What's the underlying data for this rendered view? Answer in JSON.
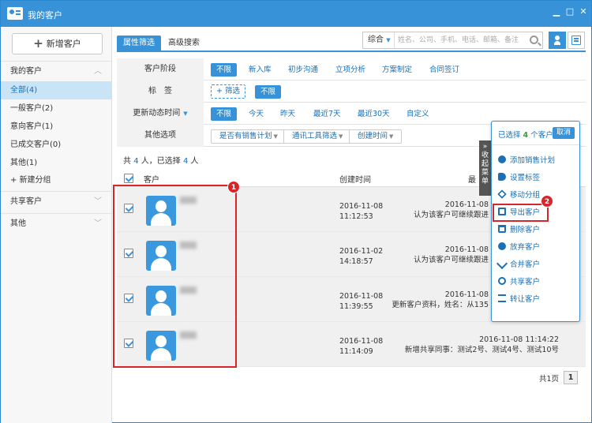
{
  "window": {
    "title": "我的客户",
    "minimize": "▁",
    "maximize": "□",
    "close": "✕"
  },
  "sidebar": {
    "new_button": "新增客户",
    "group_mine": "我的客户",
    "items": [
      {
        "label": "全部(4)"
      },
      {
        "label": "一般客户(2)"
      },
      {
        "label": "意向客户(1)"
      },
      {
        "label": "已成交客户(0)"
      },
      {
        "label": "其他(1)"
      }
    ],
    "new_group": "+ 新建分组",
    "group_shared": "共享客户",
    "group_other": "其他"
  },
  "tabs": [
    {
      "label": "属性筛选"
    },
    {
      "label": "高级搜索"
    }
  ],
  "search": {
    "type": "综合",
    "placeholder": "姓名、公司、手机、电话、邮箱、备注"
  },
  "filters": {
    "stage": {
      "label": "客户阶段",
      "options": [
        "不限",
        "新入库",
        "初步沟通",
        "立项分析",
        "方案制定",
        "合同签订"
      ]
    },
    "tags": {
      "label": "标　签",
      "add": "+ 筛选",
      "any": "不限"
    },
    "updated": {
      "label": "更新动态时间",
      "options": [
        "不限",
        "今天",
        "昨天",
        "最近7天",
        "最近30天",
        "自定义"
      ]
    },
    "other": {
      "label": "其他选项",
      "dropdowns": [
        "是否有销售计划",
        "通讯工具筛选",
        "创建时间"
      ]
    }
  },
  "summary": {
    "prefix": "共",
    "total": "4",
    "mid": "人，已选择",
    "selected": "4",
    "suffix": "人"
  },
  "table": {
    "columns": {
      "customer": "客户",
      "created": "创建时间",
      "latest": "最"
    },
    "rows": [
      {
        "date": "2016-11-08",
        "time": "11:12:53",
        "act_date": "2016-11-08",
        "act_text": "认为该客户可继续跟进"
      },
      {
        "date": "2016-11-02",
        "time": "14:18:57",
        "act_date": "2016-11-08",
        "act_text": "认为该客户可继续跟进"
      },
      {
        "date": "2016-11-08",
        "time": "11:39:55",
        "act_date": "2016-11-08",
        "act_text": "更新客户资料，姓名：从135"
      },
      {
        "date": "2016-11-08",
        "time": "11:14:09",
        "act_date": "2016-11-08 11:14:22",
        "act_text": "新增共享同事：测试2号、测试4号、测试10号"
      }
    ]
  },
  "collapse_tab": "收起菜单",
  "popup": {
    "selected_prefix": "已选择",
    "selected_count": "4",
    "selected_suffix": "个客户",
    "cancel": "取消",
    "items": [
      {
        "label": "添加销售计划",
        "icon": "plus-circle-icon"
      },
      {
        "label": "设置标签",
        "icon": "tag-icon"
      },
      {
        "label": "移动分组",
        "icon": "move-icon"
      },
      {
        "label": "导出客户",
        "icon": "export-icon"
      },
      {
        "label": "删除客户",
        "icon": "trash-icon"
      },
      {
        "label": "放弃客户",
        "icon": "x-circle-icon"
      },
      {
        "label": "合并客户",
        "icon": "merge-icon"
      },
      {
        "label": "共享客户",
        "icon": "share-icon"
      },
      {
        "label": "转让客户",
        "icon": "transfer-icon"
      }
    ]
  },
  "annotations": {
    "badge1": "1",
    "badge2": "2"
  },
  "pager": {
    "pages": "共1页",
    "current": "1"
  },
  "colors": {
    "accent": "#3892d8",
    "highlight": "#d6252b"
  }
}
